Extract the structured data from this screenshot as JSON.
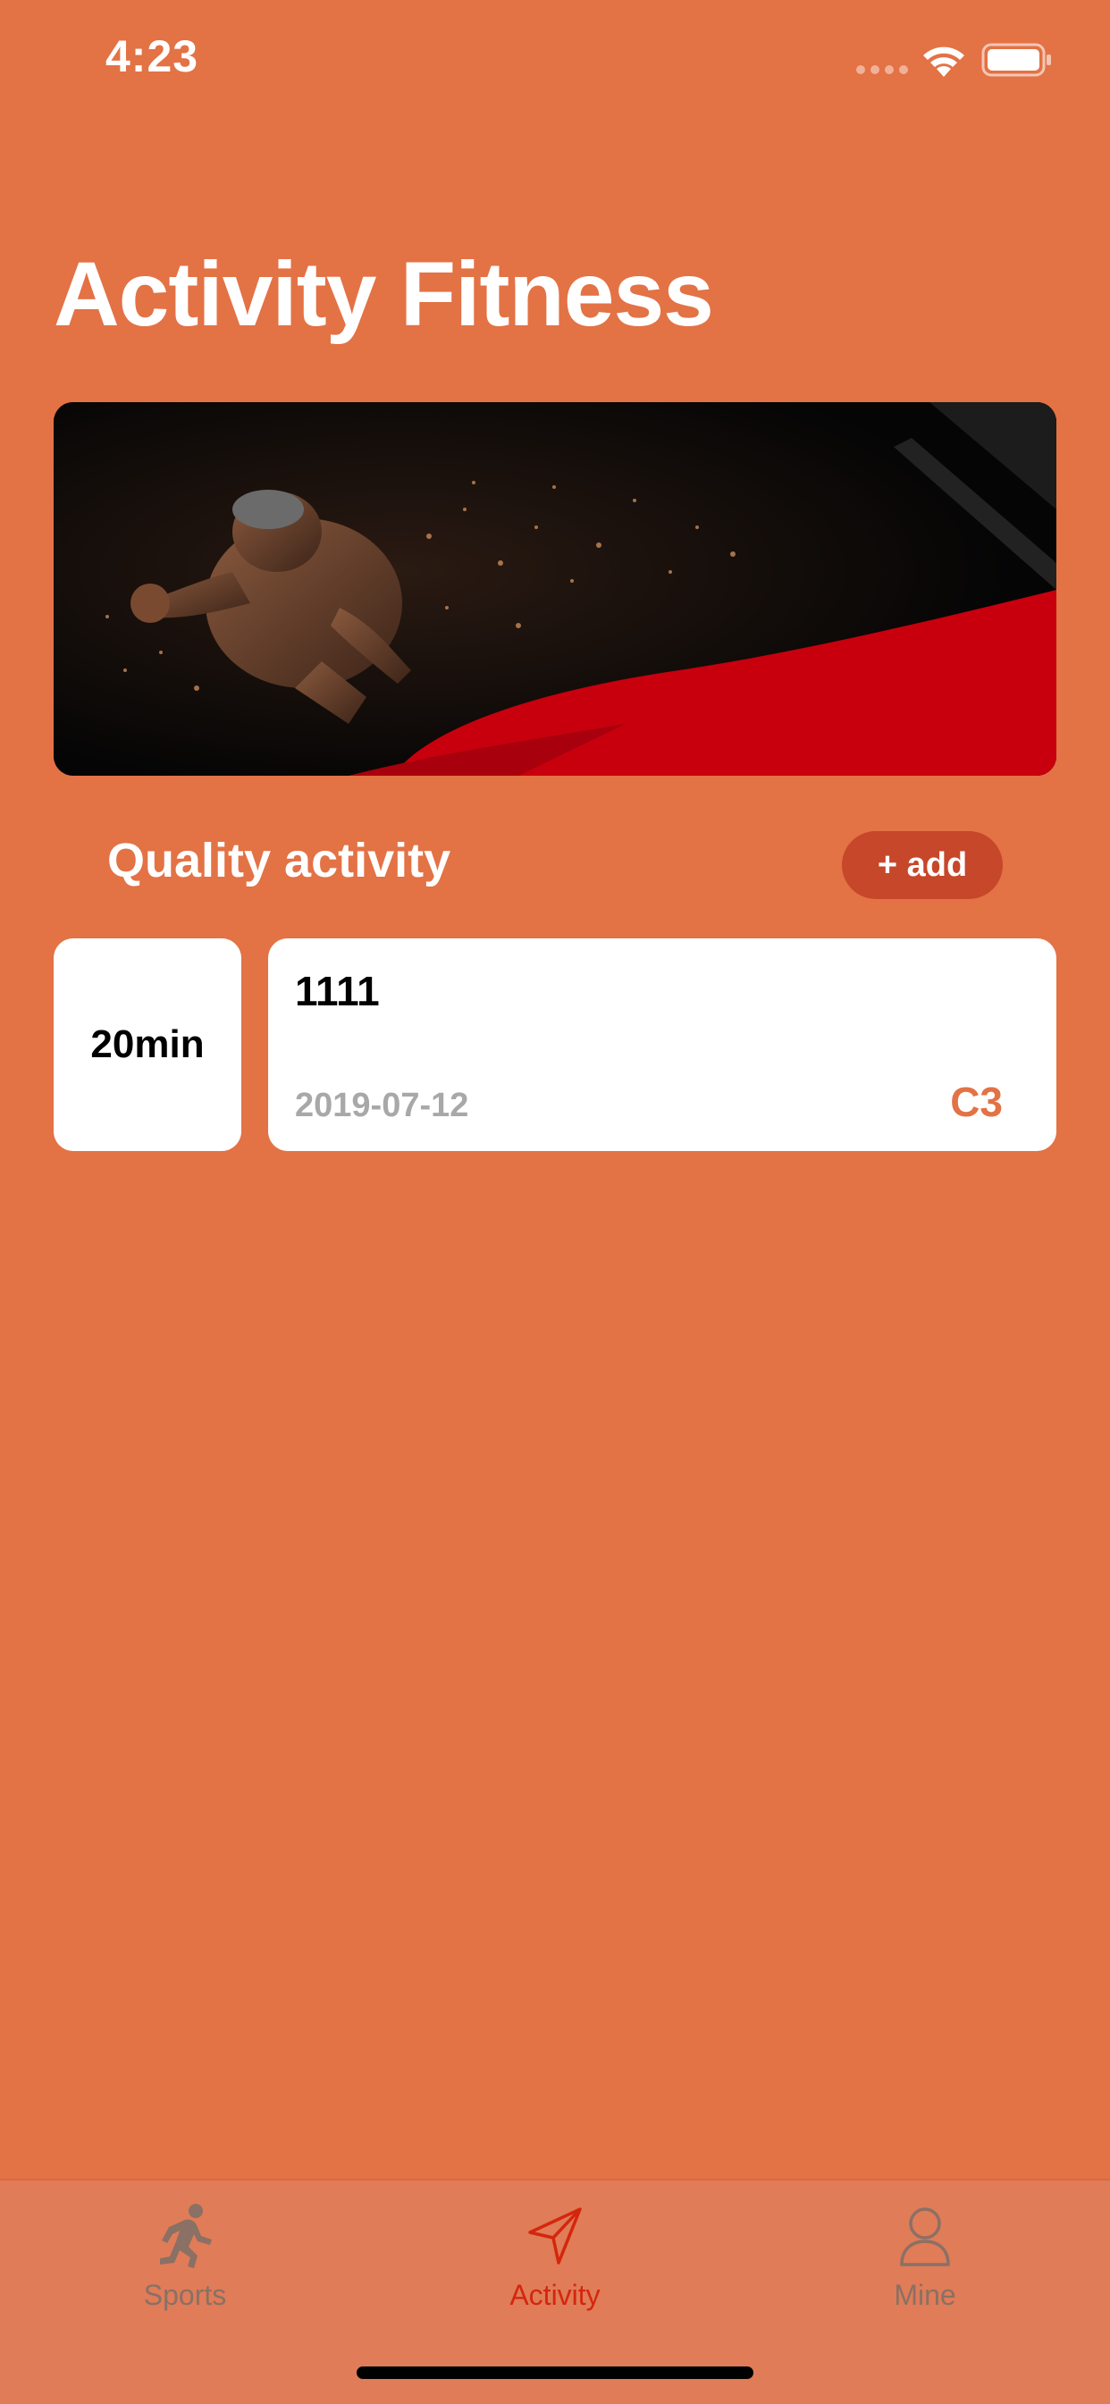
{
  "status_bar": {
    "time": "4:23"
  },
  "header": {
    "title": "Activity Fitness"
  },
  "section": {
    "title": "Quality activity",
    "add_label": "+ add"
  },
  "activities": [
    {
      "duration": "20min",
      "name": "1111",
      "date": "2019-07-12",
      "code": "C3"
    }
  ],
  "tab_bar": {
    "items": [
      {
        "label": "Sports",
        "icon": "running-person-icon",
        "active": false
      },
      {
        "label": "Activity",
        "icon": "navigation-arrow-icon",
        "active": true
      },
      {
        "label": "Mine",
        "icon": "user-icon",
        "active": false
      }
    ]
  },
  "colors": {
    "background": "#E37245",
    "add_button": "#C7472A",
    "active_tab": "#D4260E",
    "inactive_tab": "#8A7065",
    "date_text": "#A8A8A8"
  }
}
